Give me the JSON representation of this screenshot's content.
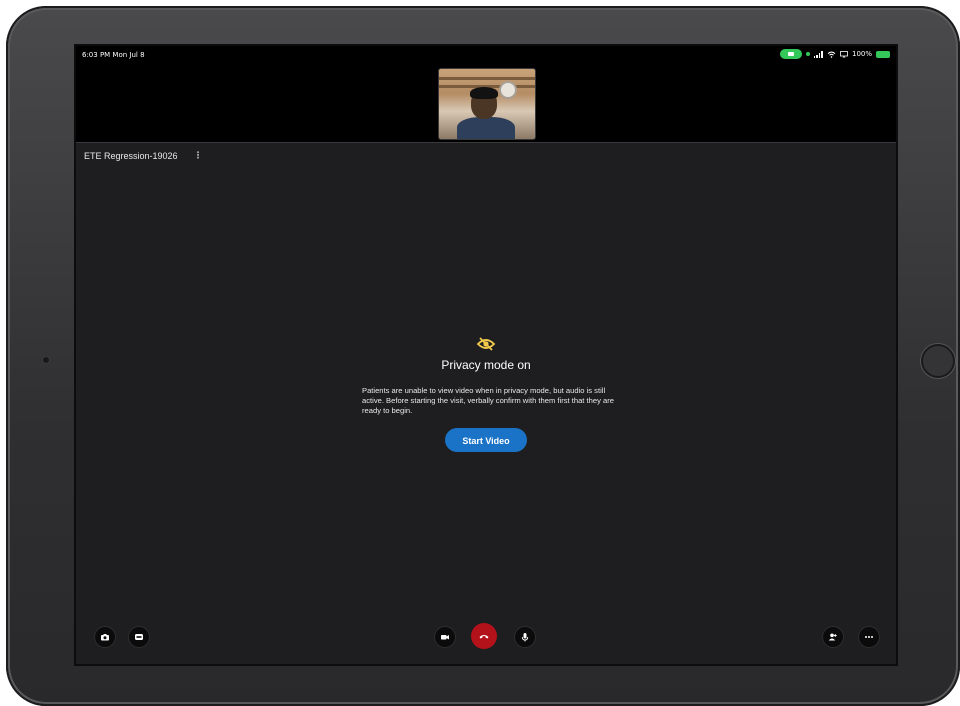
{
  "status_bar": {
    "time": "6:03 PM  Mon Jul 8",
    "battery": "100%"
  },
  "session": {
    "name": "ETE Regression-19026",
    "menu_icon": "kebab-vertical-icon"
  },
  "privacy": {
    "icon": "eye-off-icon",
    "icon_color": "#f2c94c",
    "title": "Privacy mode on",
    "message": "Patients are unable to view video when in privacy mode, but audio is still active. Before starting the visit, verbally confirm with them first that they are ready to begin.",
    "button_label": "Start Video",
    "button_color": "#1a73c7"
  },
  "toolbar": {
    "left": [
      "camera-icon",
      "screen-share-icon"
    ],
    "center": [
      "video-camera-icon",
      "end-call-icon",
      "microphone-icon"
    ],
    "right": [
      "add-participant-icon",
      "more-icon"
    ],
    "end_call_color": "#b3121a"
  }
}
